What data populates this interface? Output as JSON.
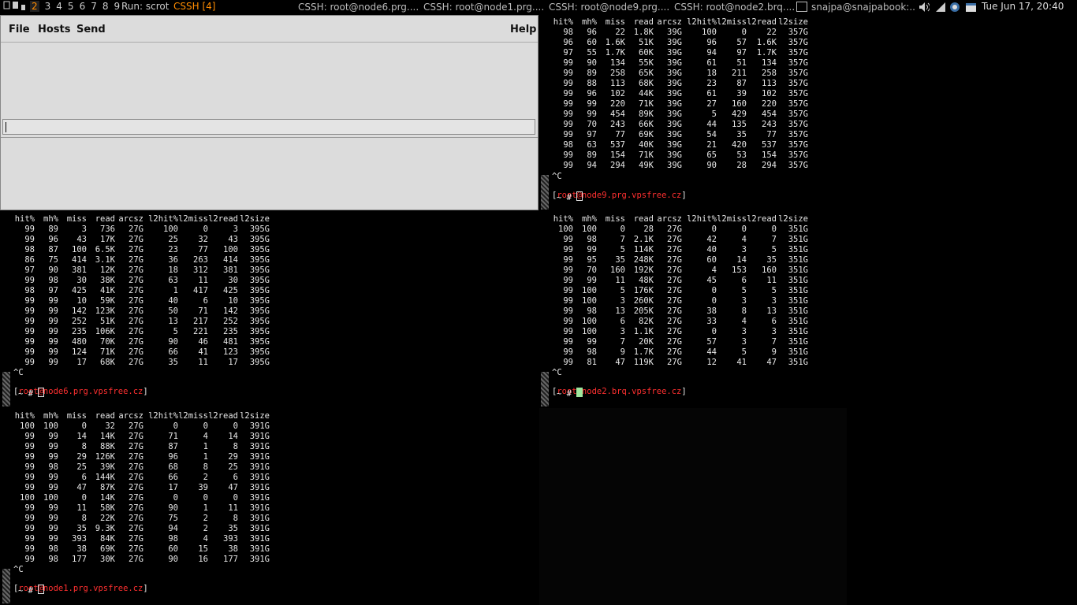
{
  "topbar": {
    "workspaces": [
      "1",
      "2",
      "3",
      "4",
      "5",
      "6",
      "7",
      "8",
      "9"
    ],
    "run_label": "Run: scrot",
    "active_title": "CSSH [4]",
    "tasks": [
      "CSSH: root@node6.prg....",
      "CSSH: root@node1.prg....",
      "CSSH: root@node9.prg....",
      "CSSH: root@node2.brq....",
      "snajpa@snajpabook:..."
    ],
    "clock": "Tue Jun 17, 20:40",
    "accent": "#ff8c00"
  },
  "cssh": {
    "menu": {
      "file": "File",
      "hosts": "Hosts",
      "send": "Send",
      "help": "Help"
    },
    "input_value": ""
  },
  "terminals": {
    "columns": [
      "hit%",
      "mh%",
      "miss",
      "read",
      "arcsz",
      "l2hit%",
      "l2miss",
      "l2read",
      "l2size"
    ],
    "node9": {
      "rows": [
        [
          "98",
          "96",
          "22",
          "1.8K",
          "39G",
          "100",
          "0",
          "22",
          "357G"
        ],
        [
          "96",
          "60",
          "1.6K",
          "51K",
          "39G",
          "96",
          "57",
          "1.6K",
          "357G"
        ],
        [
          "97",
          "55",
          "1.7K",
          "60K",
          "39G",
          "94",
          "97",
          "1.7K",
          "357G"
        ],
        [
          "99",
          "90",
          "134",
          "55K",
          "39G",
          "61",
          "51",
          "134",
          "357G"
        ],
        [
          "99",
          "89",
          "258",
          "65K",
          "39G",
          "18",
          "211",
          "258",
          "357G"
        ],
        [
          "99",
          "88",
          "113",
          "68K",
          "39G",
          "23",
          "87",
          "113",
          "357G"
        ],
        [
          "99",
          "96",
          "102",
          "44K",
          "39G",
          "61",
          "39",
          "102",
          "357G"
        ],
        [
          "99",
          "99",
          "220",
          "71K",
          "39G",
          "27",
          "160",
          "220",
          "357G"
        ],
        [
          "99",
          "99",
          "454",
          "89K",
          "39G",
          "5",
          "429",
          "454",
          "357G"
        ],
        [
          "99",
          "70",
          "243",
          "66K",
          "39G",
          "44",
          "135",
          "243",
          "357G"
        ],
        [
          "99",
          "97",
          "77",
          "69K",
          "39G",
          "54",
          "35",
          "77",
          "357G"
        ],
        [
          "98",
          "63",
          "537",
          "40K",
          "39G",
          "21",
          "420",
          "537",
          "357G"
        ],
        [
          "99",
          "89",
          "154",
          "71K",
          "39G",
          "65",
          "53",
          "154",
          "357G"
        ],
        [
          "99",
          "94",
          "294",
          "49K",
          "39G",
          "90",
          "28",
          "294",
          "357G"
        ]
      ],
      "interrupt": "^C",
      "prompt_user": "root@node9.prg.vpsfree.cz",
      "prompt_tail": "~ #"
    },
    "node6": {
      "rows": [
        [
          "99",
          "89",
          "3",
          "736",
          "27G",
          "100",
          "0",
          "3",
          "395G"
        ],
        [
          "99",
          "96",
          "43",
          "17K",
          "27G",
          "25",
          "32",
          "43",
          "395G"
        ],
        [
          "98",
          "87",
          "100",
          "6.5K",
          "27G",
          "23",
          "77",
          "100",
          "395G"
        ],
        [
          "86",
          "75",
          "414",
          "3.1K",
          "27G",
          "36",
          "263",
          "414",
          "395G"
        ],
        [
          "97",
          "90",
          "381",
          "12K",
          "27G",
          "18",
          "312",
          "381",
          "395G"
        ],
        [
          "99",
          "98",
          "30",
          "38K",
          "27G",
          "63",
          "11",
          "30",
          "395G"
        ],
        [
          "98",
          "97",
          "425",
          "41K",
          "27G",
          "1",
          "417",
          "425",
          "395G"
        ],
        [
          "99",
          "99",
          "10",
          "59K",
          "27G",
          "40",
          "6",
          "10",
          "395G"
        ],
        [
          "99",
          "99",
          "142",
          "123K",
          "27G",
          "50",
          "71",
          "142",
          "395G"
        ],
        [
          "99",
          "99",
          "252",
          "51K",
          "27G",
          "13",
          "217",
          "252",
          "395G"
        ],
        [
          "99",
          "99",
          "235",
          "106K",
          "27G",
          "5",
          "221",
          "235",
          "395G"
        ],
        [
          "99",
          "99",
          "480",
          "70K",
          "27G",
          "90",
          "46",
          "481",
          "395G"
        ],
        [
          "99",
          "99",
          "124",
          "71K",
          "27G",
          "66",
          "41",
          "123",
          "395G"
        ],
        [
          "99",
          "99",
          "17",
          "68K",
          "27G",
          "35",
          "11",
          "17",
          "395G"
        ]
      ],
      "interrupt": "^C",
      "prompt_user": "root@node6.prg.vpsfree.cz",
      "prompt_tail": "~ #"
    },
    "node2": {
      "rows": [
        [
          "100",
          "100",
          "0",
          "28",
          "27G",
          "0",
          "0",
          "0",
          "351G"
        ],
        [
          "99",
          "98",
          "7",
          "2.1K",
          "27G",
          "42",
          "4",
          "7",
          "351G"
        ],
        [
          "99",
          "99",
          "5",
          "114K",
          "27G",
          "40",
          "3",
          "5",
          "351G"
        ],
        [
          "99",
          "95",
          "35",
          "248K",
          "27G",
          "60",
          "14",
          "35",
          "351G"
        ],
        [
          "99",
          "70",
          "160",
          "192K",
          "27G",
          "4",
          "153",
          "160",
          "351G"
        ],
        [
          "99",
          "99",
          "11",
          "48K",
          "27G",
          "45",
          "6",
          "11",
          "351G"
        ],
        [
          "99",
          "100",
          "5",
          "176K",
          "27G",
          "0",
          "5",
          "5",
          "351G"
        ],
        [
          "99",
          "100",
          "3",
          "260K",
          "27G",
          "0",
          "3",
          "3",
          "351G"
        ],
        [
          "99",
          "98",
          "13",
          "205K",
          "27G",
          "38",
          "8",
          "13",
          "351G"
        ],
        [
          "99",
          "100",
          "6",
          "82K",
          "27G",
          "33",
          "4",
          "6",
          "351G"
        ],
        [
          "99",
          "100",
          "3",
          "1.1K",
          "27G",
          "0",
          "3",
          "3",
          "351G"
        ],
        [
          "99",
          "99",
          "7",
          "20K",
          "27G",
          "57",
          "3",
          "7",
          "351G"
        ],
        [
          "99",
          "98",
          "9",
          "1.7K",
          "27G",
          "44",
          "5",
          "9",
          "351G"
        ],
        [
          "99",
          "81",
          "47",
          "119K",
          "27G",
          "12",
          "41",
          "47",
          "351G"
        ]
      ],
      "interrupt": "^C",
      "prompt_user": "root@node2.brq.vpsfree.cz",
      "prompt_tail": "~ #"
    },
    "node1": {
      "rows": [
        [
          "100",
          "100",
          "0",
          "32",
          "27G",
          "0",
          "0",
          "0",
          "391G"
        ],
        [
          "99",
          "99",
          "14",
          "14K",
          "27G",
          "71",
          "4",
          "14",
          "391G"
        ],
        [
          "99",
          "99",
          "8",
          "88K",
          "27G",
          "87",
          "1",
          "8",
          "391G"
        ],
        [
          "99",
          "99",
          "29",
          "126K",
          "27G",
          "96",
          "1",
          "29",
          "391G"
        ],
        [
          "99",
          "98",
          "25",
          "39K",
          "27G",
          "68",
          "8",
          "25",
          "391G"
        ],
        [
          "99",
          "99",
          "6",
          "144K",
          "27G",
          "66",
          "2",
          "6",
          "391G"
        ],
        [
          "99",
          "99",
          "47",
          "87K",
          "27G",
          "17",
          "39",
          "47",
          "391G"
        ],
        [
          "100",
          "100",
          "0",
          "14K",
          "27G",
          "0",
          "0",
          "0",
          "391G"
        ],
        [
          "99",
          "99",
          "11",
          "58K",
          "27G",
          "90",
          "1",
          "11",
          "391G"
        ],
        [
          "99",
          "99",
          "8",
          "22K",
          "27G",
          "75",
          "2",
          "8",
          "391G"
        ],
        [
          "99",
          "99",
          "35",
          "9.3K",
          "27G",
          "94",
          "2",
          "35",
          "391G"
        ],
        [
          "99",
          "99",
          "393",
          "84K",
          "27G",
          "98",
          "4",
          "393",
          "391G"
        ],
        [
          "99",
          "98",
          "38",
          "69K",
          "27G",
          "60",
          "15",
          "38",
          "391G"
        ],
        [
          "99",
          "98",
          "177",
          "30K",
          "27G",
          "90",
          "16",
          "177",
          "391G"
        ]
      ],
      "interrupt": "^C",
      "prompt_user": "root@node1.prg.vpsfree.cz",
      "prompt_tail": "~ #"
    }
  }
}
